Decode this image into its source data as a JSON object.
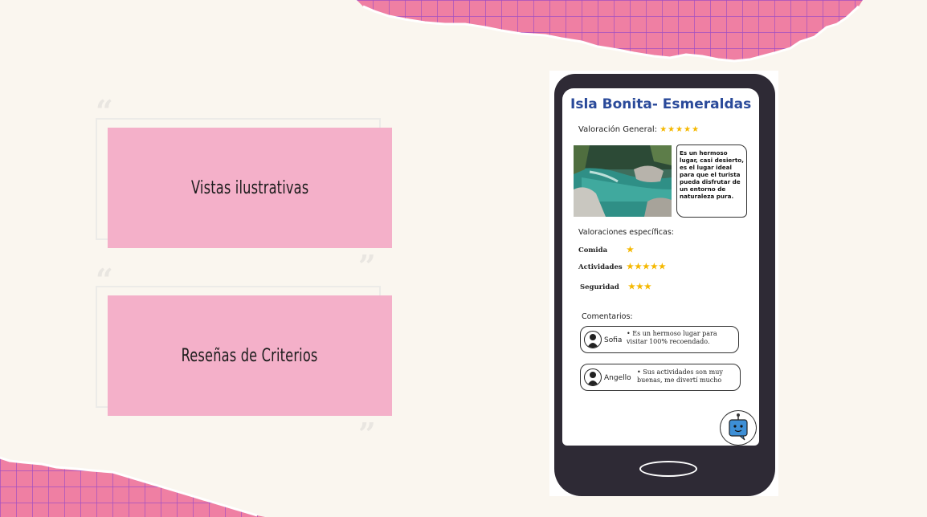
{
  "slide": {
    "cards": [
      {
        "label": "Vistas ilustrativas"
      },
      {
        "label": "Reseñas de Criterios"
      }
    ],
    "colors": {
      "background": "#faf6ef",
      "pink_panel": "#f4b0c9",
      "torn_pink": "#ef7fa3",
      "grid_purple": "#a24fc2"
    }
  },
  "app": {
    "title": "Isla Bonita- Esmeraldas",
    "overall_label": "Valoración General:",
    "overall_stars": "★★★★★",
    "description": "Es un hermoso lugar, casi desierto, es el lugar ideal para que el turista pueda disfrutar de un entorno de naturaleza pura.",
    "specific_title": "Valoraciones específicas:",
    "criteria": [
      {
        "label": "Comida",
        "stars": "★"
      },
      {
        "label": "Actividades",
        "stars": "★★★★★"
      },
      {
        "label": "Seguridad",
        "stars": "★★★"
      }
    ],
    "comments_title": "Comentarios:",
    "comments": [
      {
        "name": "Sofia",
        "text": "• Es un hermoso lugar para visitar 100% recoendado."
      },
      {
        "name": "Angello",
        "text": "• Sus actividades son muy buenas, me divertí mucho"
      }
    ]
  }
}
